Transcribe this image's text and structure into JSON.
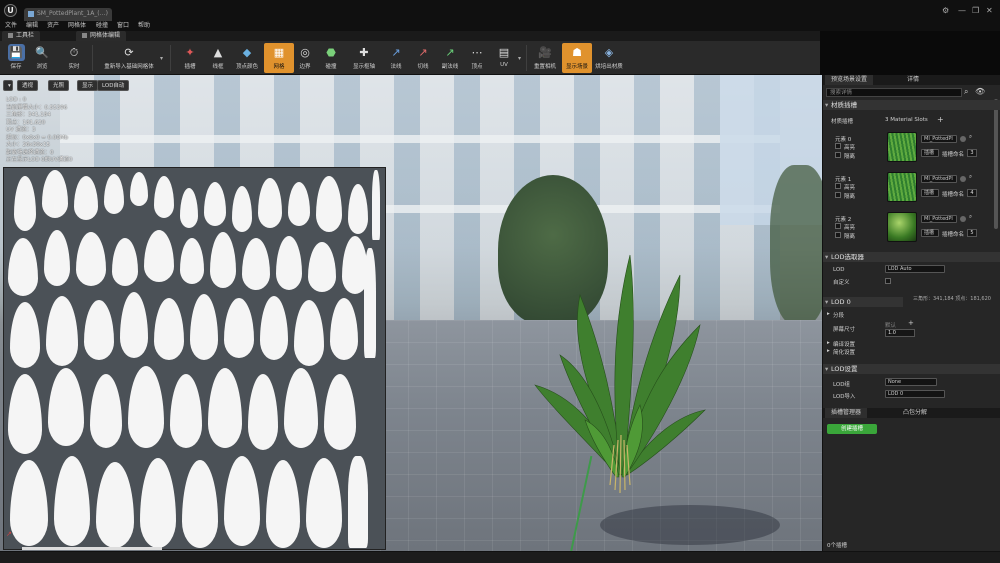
{
  "titlebar": {
    "tab_label": "SM_PottedPlant_1A_(…)",
    "min_glyph": "—",
    "max_glyph": "❐",
    "close_glyph": "✕"
  },
  "menu": [
    "文件",
    "编辑",
    "资产",
    "网格体",
    "碰撞",
    "窗口",
    "帮助"
  ],
  "panel_tabs": [
    "工具栏",
    "网格体编辑"
  ],
  "toolbar": [
    {
      "label": "保存",
      "icon": "save-icon",
      "glyph": "💾"
    },
    {
      "label": "浏览",
      "icon": "browse-icon",
      "glyph": "🔍"
    },
    {
      "label": "实时",
      "icon": "realtime-icon",
      "glyph": "⏱"
    },
    {
      "label": "重新导入基础网格体",
      "icon": "reimport-icon",
      "glyph": "⟳"
    },
    {
      "label": "插槽",
      "icon": "socket-icon",
      "glyph": "✦"
    },
    {
      "label": "线框",
      "icon": "wireframe-icon",
      "glyph": "▲"
    },
    {
      "label": "顶点颜色",
      "icon": "vertex-color-icon",
      "glyph": "◆"
    },
    {
      "label": "网格",
      "icon": "grid-icon",
      "glyph": "▦"
    },
    {
      "label": "边界",
      "icon": "bounds-icon",
      "glyph": "◎"
    },
    {
      "label": "碰撞",
      "icon": "collision-icon",
      "glyph": "⬣"
    },
    {
      "label": "显示枢轴",
      "icon": "pivot-icon",
      "glyph": "✚"
    },
    {
      "label": "法线",
      "icon": "normals-icon",
      "glyph": "↗"
    },
    {
      "label": "切线",
      "icon": "tangents-icon",
      "glyph": "↗"
    },
    {
      "label": "副法线",
      "icon": "binormals-icon",
      "glyph": "↗"
    },
    {
      "label": "顶点",
      "icon": "vertices-icon",
      "glyph": "⋯"
    },
    {
      "label": "UV",
      "icon": "uv-icon",
      "glyph": "▤"
    },
    {
      "label": "重置相机",
      "icon": "reset-camera-icon",
      "glyph": "🎥"
    },
    {
      "label": "显示场景",
      "icon": "show-scene-icon",
      "glyph": "☗"
    },
    {
      "label": "烘培出材质",
      "icon": "bake-material-icon",
      "glyph": "◈"
    }
  ],
  "viewport": {
    "buttons": [
      "透视",
      "光照",
      "显示",
      "LOD自动"
    ],
    "stats": [
      "LOD : 0",
      "当前屏幕大小：0.55396",
      "三角形：341,184",
      "顶点：181,620",
      "UV 通道：3",
      "近似：0x0x0 = 0.00Mb",
      "大小：26x30x15",
      "距离场选择通道：0",
      "正在显示LOD 0的UV通道0"
    ]
  },
  "right_panel": {
    "tabs": [
      "预览场景设置",
      "详情"
    ],
    "search_placeholder": "搜索详情",
    "material_section": "材质插槽",
    "material_label": "材质插槽",
    "material_slots_count": "3 Material Slots",
    "elements": [
      {
        "name": "元素 0",
        "material": "MI_PottedPl",
        "slot_label": "插槽",
        "slot_name": "插槽命名",
        "index": "3"
      },
      {
        "name": "元素 1",
        "material": "MI_PottedPl",
        "slot_label": "插槽",
        "slot_name": "插槽命名",
        "index": "4"
      },
      {
        "name": "元素 2",
        "material": "MI_PottedPl",
        "slot_label": "插槽",
        "slot_name": "插槽命名",
        "index": "5"
      }
    ],
    "highlight_label": "高亮",
    "isolate_label": "隔离",
    "lod_picker_section": "LOD选取器",
    "lod_label": "LOD",
    "lod_value": "LOD Auto",
    "custom_label": "自定义",
    "lod_summary": "三角形：341,184    顶点：181,620",
    "lod0_section": "LOD 0",
    "sections_label": "分段",
    "screen_size_label": "屏幕尺寸",
    "screen_size_default": "默认",
    "screen_size_value": "1.0",
    "build_settings": "编译设置",
    "reduction_settings": "简化设置",
    "lod_settings_section": "LOD设置",
    "lod_group_label": "LOD组",
    "lod_group_value": "None",
    "lod_import_label": "LOD导入",
    "lod_import_value": "LOD 0",
    "socket_tabs": [
      "插槽管理器",
      "凸包分解"
    ],
    "create_socket": "创建插槽",
    "socket_count": "0个插槽"
  }
}
